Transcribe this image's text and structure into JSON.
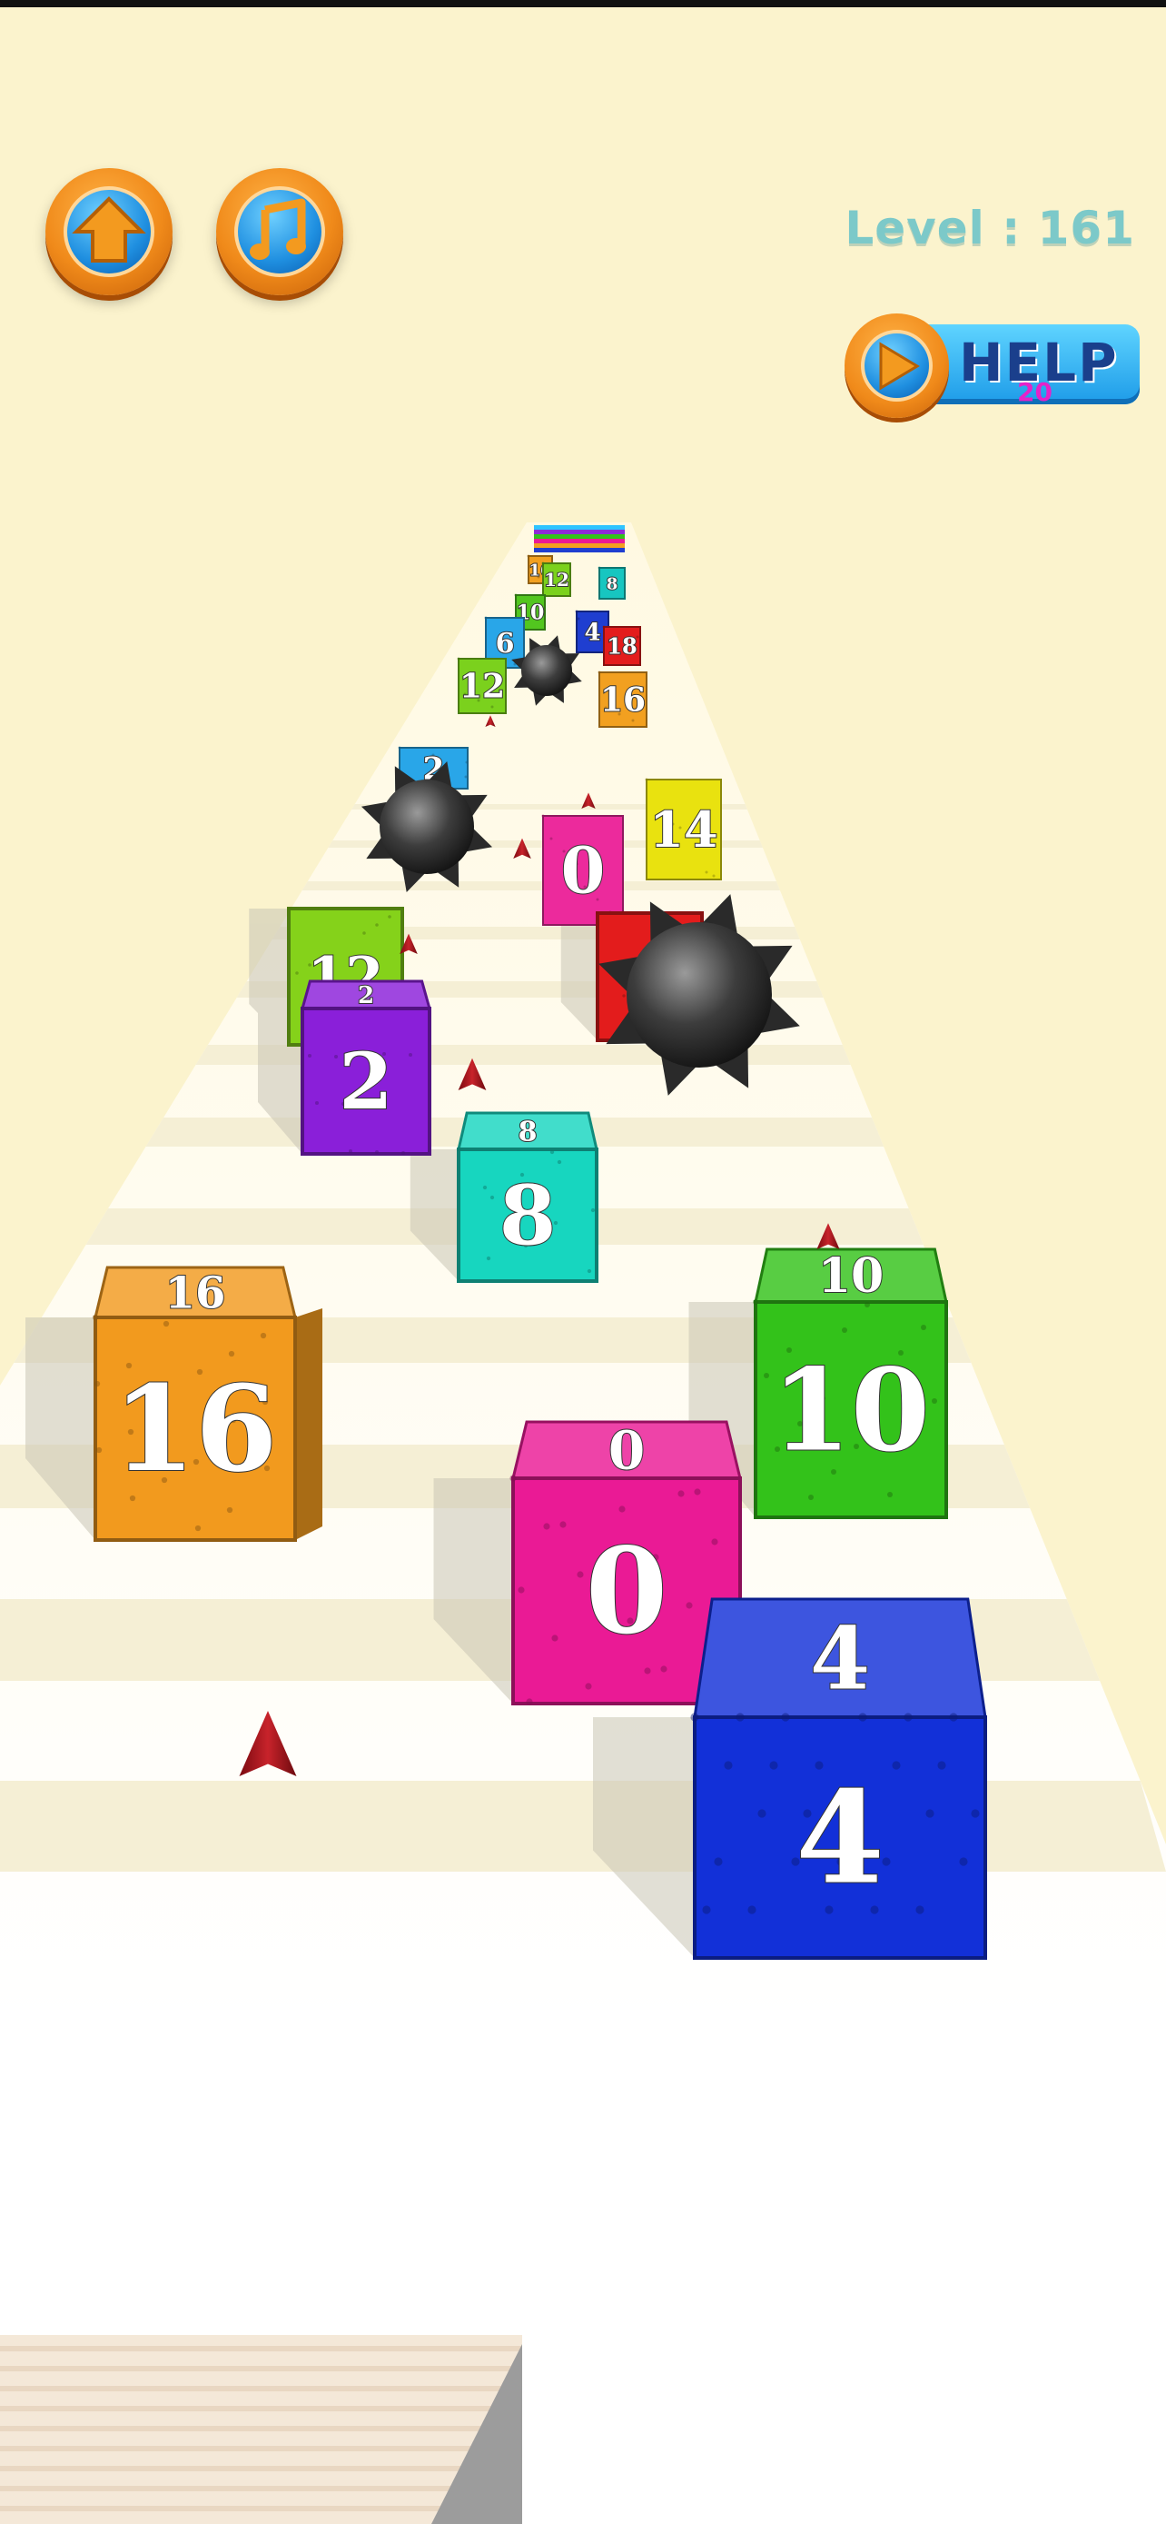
{
  "hud": {
    "home_icon": "home-arrow-icon",
    "music_icon": "music-note-icon",
    "level_text": "Level : 161",
    "help": {
      "label": "HELP",
      "count": "20",
      "icon": "play-icon"
    }
  },
  "colors": {
    "background": "#fbf3cd",
    "track_light": "#fffdf3",
    "track_stripe": "#f6f0d8",
    "orange_button": "#f08a1a",
    "blue_button": "#1f8fe0",
    "level_text": "#7cc9c9",
    "spike_cone": "#a8121a"
  },
  "cubes": [
    {
      "value": "16",
      "color": "#f29a1e"
    },
    {
      "value": "10",
      "color": "#33c21a"
    },
    {
      "value": "0",
      "color": "#ea1a95"
    },
    {
      "value": "4",
      "color": "#1230d8"
    },
    {
      "value": "8",
      "color": "#17d6bf"
    },
    {
      "value": "2",
      "color": "#8a1fd9"
    },
    {
      "value": "0",
      "color": "#ec2a9c"
    },
    {
      "value": "14",
      "color": "#e9e20f"
    },
    {
      "value": "12",
      "color": "#85d21a"
    },
    {
      "value": "18",
      "color": "#e31c1c"
    },
    {
      "value": "2",
      "color": "#29a6e8"
    },
    {
      "value": "12",
      "color": "#7bd11d"
    },
    {
      "value": "16",
      "color": "#f2a020"
    },
    {
      "value": "6",
      "color": "#29a6e8"
    },
    {
      "value": "4",
      "color": "#1f3ed0"
    },
    {
      "value": "18",
      "color": "#e31c1c"
    },
    {
      "value": "10",
      "color": "#52c61f"
    },
    {
      "value": "12",
      "color": "#7bd11d"
    },
    {
      "value": "16",
      "color": "#f2a020"
    },
    {
      "value": "8",
      "color": "#17c6c0"
    }
  ],
  "obstacles": {
    "spike_balls": 3,
    "spike_cones": 7
  }
}
